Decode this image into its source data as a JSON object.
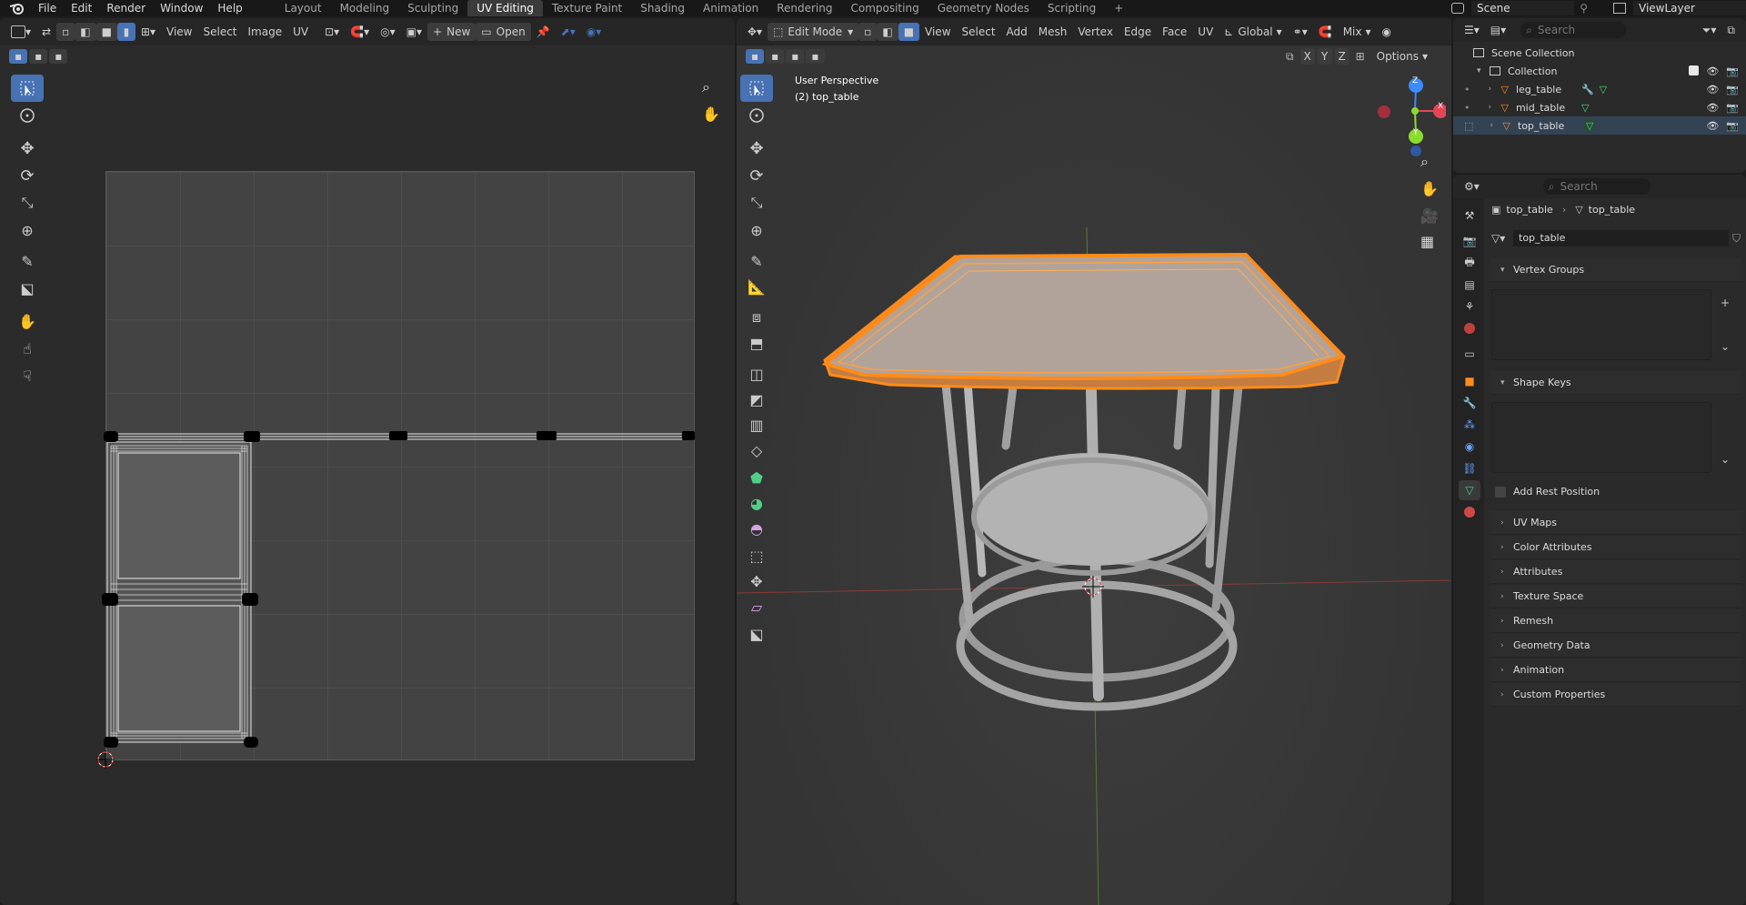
{
  "menubar": {
    "items": [
      "File",
      "Edit",
      "Render",
      "Window",
      "Help"
    ]
  },
  "workspaces": [
    "Layout",
    "Modeling",
    "Sculpting",
    "UV Editing",
    "Texture Paint",
    "Shading",
    "Animation",
    "Rendering",
    "Compositing",
    "Geometry Nodes",
    "Scripting"
  ],
  "active_workspace": "UV Editing",
  "add_workspace": "+",
  "scene": {
    "label": "Scene",
    "viewlayer": "ViewLayer"
  },
  "uv_editor": {
    "menus": [
      "View",
      "Select",
      "Image",
      "UV"
    ],
    "new_label": "New",
    "open_label": "Open",
    "new_prefix": "+"
  },
  "viewport": {
    "mode": "Edit Mode",
    "menus": [
      "View",
      "Select",
      "Add",
      "Mesh",
      "Vertex",
      "Edge",
      "Face",
      "UV"
    ],
    "orientation": "Global",
    "shading": "Mix",
    "axes": [
      "X",
      "Y",
      "Z"
    ],
    "options_label": "Options",
    "perspective": "User Perspective",
    "object_info": "(2) top_table"
  },
  "gizmo": {
    "x": "X",
    "y": "Y",
    "z": "Z"
  },
  "outliner": {
    "search_placeholder": "Search",
    "scene_collection": "Scene Collection",
    "collection": "Collection",
    "objects": [
      "leg_table",
      "mid_table",
      "top_table"
    ]
  },
  "properties": {
    "search_placeholder": "Search",
    "breadcrumb_object": "top_table",
    "breadcrumb_mesh": "top_table",
    "mesh_name": "top_table",
    "sections": {
      "vertex_groups": "Vertex Groups",
      "shape_keys": "Shape Keys",
      "add_rest_position": "Add Rest Position",
      "uv_maps": "UV Maps",
      "color_attributes": "Color Attributes",
      "attributes": "Attributes",
      "texture_space": "Texture Space",
      "remesh": "Remesh",
      "geometry_data": "Geometry Data",
      "animation": "Animation",
      "custom_properties": "Custom Properties"
    }
  },
  "colors": {
    "accent": "#4772b3",
    "selection_orange": "#ff8c1a",
    "mesh_green": "#4fd08a",
    "axis_red": "#e64557",
    "axis_green": "#8bdc2d",
    "axis_blue": "#3d8bff"
  }
}
